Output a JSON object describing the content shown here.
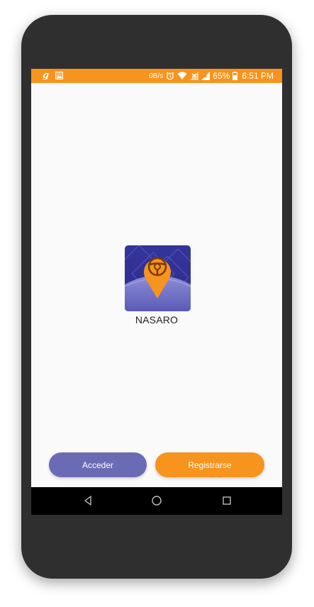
{
  "status_bar": {
    "left_icons": [
      "g-app-icon",
      "image-icon"
    ],
    "g_label": "g",
    "speed": "0B/s",
    "battery": "65%",
    "time": "6:51 PM",
    "right_icons": [
      "alarm-icon",
      "wifi-icon",
      "signal-no-sim-icon",
      "signal-icon",
      "battery-icon"
    ]
  },
  "app": {
    "name": "NASARO",
    "logo_icon": "map-pin-steering-wheel-icon"
  },
  "buttons": {
    "login_label": "Acceder",
    "register_label": "Registrarse"
  },
  "nav_bar": {
    "icons": [
      "back-icon",
      "home-icon",
      "recents-icon"
    ]
  },
  "colors": {
    "accent_orange": "#f7941d",
    "primary_purple": "#6b6bb5",
    "logo_blue": "#3a3a9e",
    "screen_background": "#fafafa",
    "device_frame": "#2f2f2f"
  }
}
